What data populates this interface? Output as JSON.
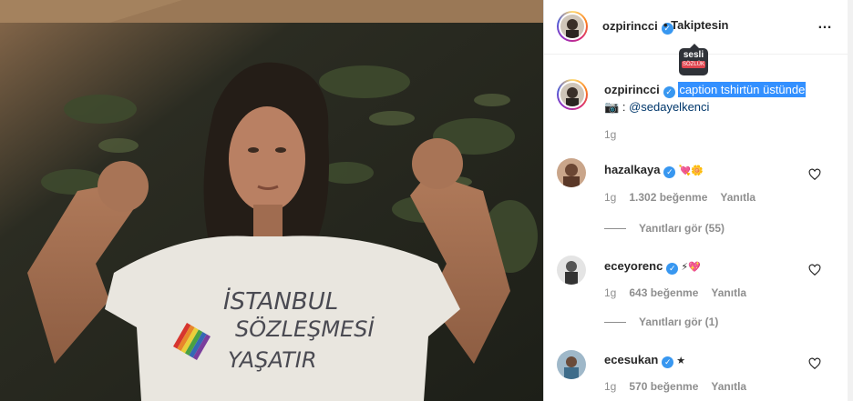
{
  "post": {
    "username": "ozpirincci",
    "follow_status": "• Takiptesin",
    "more_icon": "…"
  },
  "tooltip": {
    "line1": "sesli",
    "line2": "SÖZLÜK"
  },
  "caption": {
    "username": "ozpirincci",
    "text": "caption tshirtün üstünde",
    "credit_icon": "camera-icon",
    "credit_separator": ":",
    "credit_mention": "@sedayelkenci",
    "time": "1g"
  },
  "photo": {
    "shirt_text": [
      "İSTANBUL",
      "SÖZLEŞMESİ",
      "YAŞATIR"
    ]
  },
  "comments": [
    {
      "username": "hazalkaya",
      "emoji": "💘🌼",
      "time": "1g",
      "likes": "1.302 beğenme",
      "reply": "Yanıtla",
      "view_replies": "Yanıtları gör (55)"
    },
    {
      "username": "eceyorenc",
      "emoji": "⚡💖",
      "time": "1g",
      "likes": "643 beğenme",
      "reply": "Yanıtla",
      "view_replies": "Yanıtları gör (1)"
    },
    {
      "username": "ecesukan",
      "emoji": "★",
      "time": "1g",
      "likes": "570 beğenme",
      "reply": "Yanıtla",
      "view_replies": ""
    }
  ]
}
